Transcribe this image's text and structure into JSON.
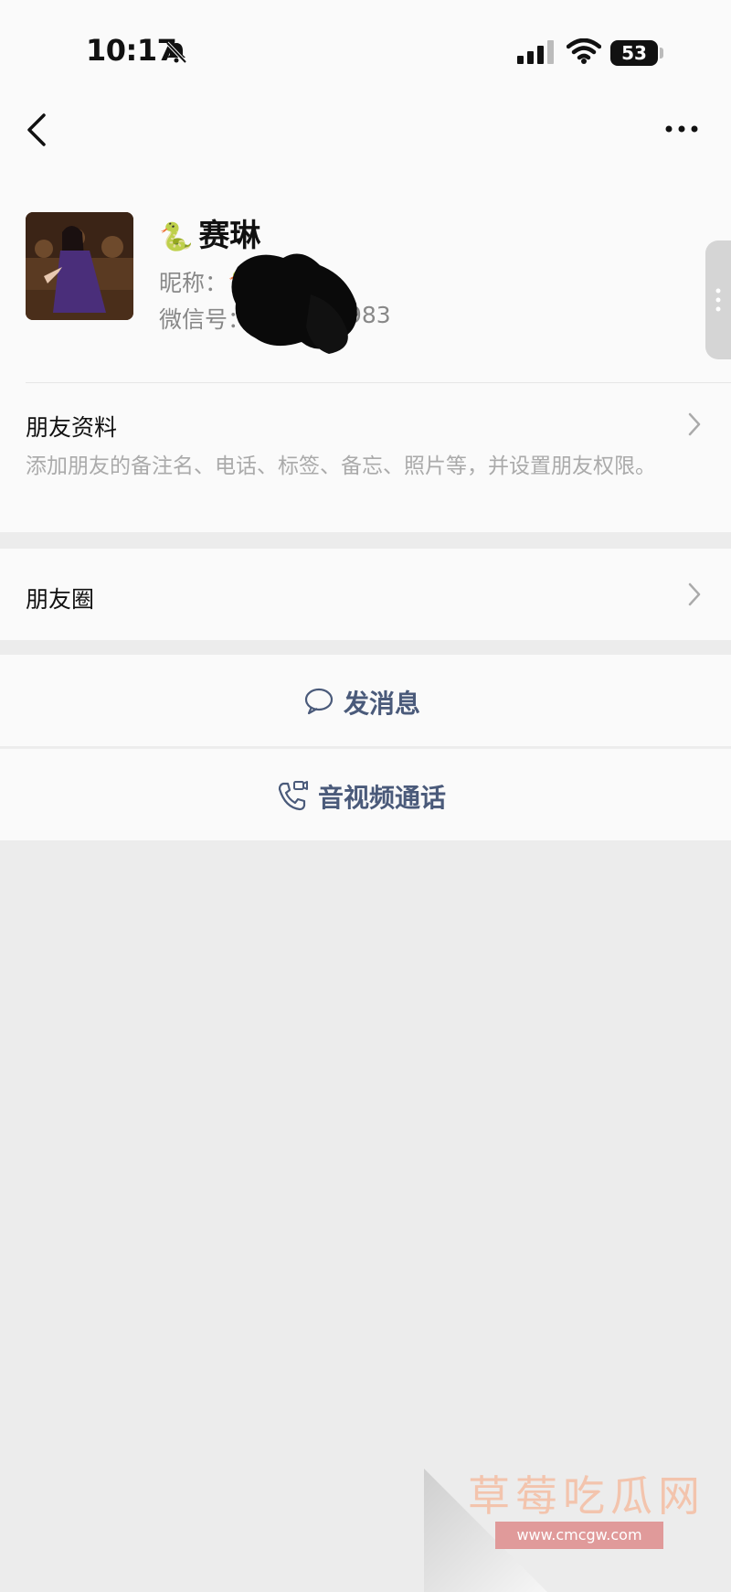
{
  "status": {
    "time": "10:17",
    "battery": "53"
  },
  "profile": {
    "emoji": "🐍",
    "name": "赛琳",
    "nickname_label": "昵称：",
    "nickname_emoji": "🐍",
    "wechat_label": "微信号：",
    "wechat_tail": "983"
  },
  "friend_info": {
    "title": "朋友资料",
    "description": "添加朋友的备注名、电话、标签、备忘、照片等，并设置朋友权限。"
  },
  "moments": {
    "title": "朋友圈"
  },
  "actions": {
    "message_label": "发消息",
    "call_label": "音视频通话"
  },
  "watermark": {
    "title": "草莓吃瓜网",
    "url": "www.cmcgw.com"
  }
}
